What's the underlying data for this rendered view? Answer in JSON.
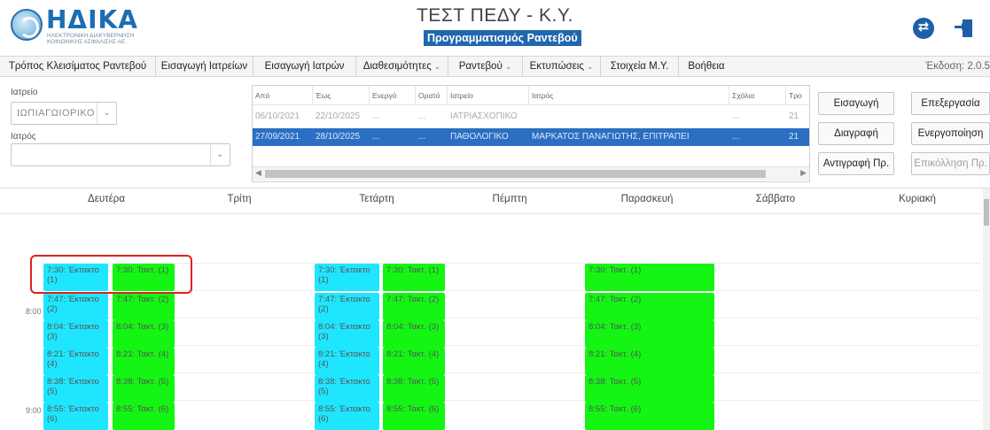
{
  "header": {
    "logo_title": "ΗΔΙΚΑ",
    "logo_subtitle": "ΗΛΕΚΤΡΟΝΙΚΗ ΔΙΑΚΥΒΕΡΝΗΣΗ ΚΟΙΝΩΝΙΚΗΣ ΑΣΦΑΛΙΣΗΣ ΑΕ.",
    "app_title": "ΤΕΣΤ ΠΕΔΥ - Κ.Υ.",
    "app_subtitle": "Προγραμματισμός Ραντεβού",
    "icons": [
      "swap-icon",
      "exit-icon"
    ]
  },
  "menu": {
    "items": [
      {
        "label": "Τρόπος Κλεισίματος Ραντεβού"
      },
      {
        "label": "Εισαγωγή Ιατρείων"
      },
      {
        "label": "Εισαγωγή Ιατρών"
      },
      {
        "label": "Διαθεσιμότητες",
        "caret": "⌄"
      },
      {
        "label": "Ραντεβού",
        "caret": "⌄"
      },
      {
        "label": "Εκτυπώσεις",
        "caret": "⌄"
      },
      {
        "label": "Στοιχεία Μ.Υ."
      },
      {
        "label": "Βοήθεια"
      }
    ],
    "version": "Έκδοση: 2.0.5"
  },
  "filters": {
    "clinic_label": "Ιατρείο",
    "clinic_value": "ΙΩΠΙΑΓΩΙΟΡΙΚΟ",
    "doctor_label": "Ιατρός",
    "doctor_value": ""
  },
  "grid": {
    "columns": [
      "Από",
      "Έως",
      "Ενεργό",
      "Ορατό",
      "Ιατρείο",
      "Ιατρός",
      "Σχόλια",
      "Τρο"
    ],
    "rows": [
      [
        "06/10/2021",
        "22/10/2025",
        "...",
        "...",
        "ΙΑΤΡΙΑΣΧΟΠΙΚΟ",
        "",
        "...",
        "21"
      ],
      [
        "27/09/2021",
        "28/10/2025",
        "...",
        "...",
        "ΠΑΘΟΛΟΓΙΚΟ",
        "ΜΑΡΚΑΤΟΣ ΠΑΝΑΓΙΩΤΗΣ, ΕΠΙΤΡΑΠΕΙ",
        "...",
        "21"
      ]
    ]
  },
  "actions": {
    "insert": "Εισαγωγή",
    "edit": "Επεξεργασία",
    "delete": "Διαγραφή",
    "activate": "Ενεργοποίηση",
    "copy": "Αντιγραφή Πρ.",
    "paste": "Επικόλληση Πρ."
  },
  "calendar": {
    "days": [
      "Δευτέρα",
      "Τρίτη",
      "Τετάρτη",
      "Πέμπτη",
      "Παρασκευή",
      "Σάββατο",
      "Κυριακή"
    ],
    "hours": [
      "8:00",
      "9:00"
    ],
    "monday": {
      "extra": [
        "7:30: Έκτακτο (1)",
        "7:47: Έκτακτο (2)",
        "8:04: Έκτακτο (3)",
        "8:21: Έκτακτο (4)",
        "8:38: Έκτακτο (5)",
        "8:55: Έκτακτο (6)"
      ],
      "regular": [
        "7:30: Τακτ. (1)",
        "7:47: Τακτ. (2)",
        "8:04: Τακτ. (3)",
        "8:21: Τακτ. (4)",
        "8:38: Τακτ. (5)",
        "8:55: Τακτ. (6)"
      ]
    },
    "wednesday": {
      "extra": [
        "7:30: Έκτακτο (1)",
        "7:47: Έκτακτο (2)",
        "8:04: Έκτακτο (3)",
        "8:21: Έκτακτο (4)",
        "8:38: Έκτακτο (5)",
        "8:55: Έκτακτο (6)"
      ],
      "regular": [
        "7:30: Τακτ. (1)",
        "7:47: Τακτ. (2)",
        "8:04: Τακτ. (3)",
        "8:21: Τακτ. (4)",
        "8:38: Τακτ. (5)",
        "8:55: Τακτ. (6)"
      ]
    },
    "friday": {
      "regular": [
        "7:30: Τακτ. (1)",
        "7:47: Τακτ. (2)",
        "8:04: Τακτ. (3)",
        "8:21: Τακτ. (4)",
        "8:38: Τακτ. (5)",
        "8:55: Τακτ. (6)"
      ]
    },
    "colors": {
      "extra": "#1fe6ff",
      "regular": "#14f514",
      "highlight": "#e0201c"
    }
  }
}
